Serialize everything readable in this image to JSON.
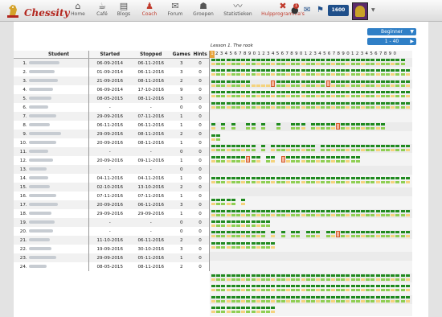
{
  "app": {
    "name": "Chessity"
  },
  "nav": [
    {
      "label": "Home",
      "icon": "home-icon",
      "glyph": "⌂"
    },
    {
      "label": "Café",
      "icon": "cafe-icon",
      "glyph": "☕"
    },
    {
      "label": "Blogs",
      "icon": "blogs-icon",
      "glyph": "▤"
    },
    {
      "label": "Coach",
      "icon": "coach-icon",
      "glyph": "♟",
      "active": true
    },
    {
      "label": "Forum",
      "icon": "forum-icon",
      "glyph": "✉"
    },
    {
      "label": "Groepen",
      "icon": "groups-icon",
      "glyph": "☗"
    },
    {
      "label": "Statistieken",
      "icon": "stats-icon",
      "glyph": "〰"
    },
    {
      "label": "Hulpprogramma's",
      "icon": "tools-icon",
      "glyph": "✖",
      "active": true
    }
  ],
  "user": {
    "notifications": "1",
    "rating": "1600"
  },
  "level_select": {
    "value": "Beginner"
  },
  "range_select": {
    "value": "1 - 40"
  },
  "lesson_title": "Lesson 1. The rook",
  "lesson_numbers": [
    "1",
    "2",
    "3",
    "4",
    "5",
    "6",
    "7",
    "8",
    "9",
    "0",
    "1",
    "2",
    "3",
    "4",
    "5",
    "6",
    "7",
    "8",
    "9",
    "0",
    "1",
    "2",
    "3",
    "4",
    "5",
    "6",
    "7",
    "8",
    "9",
    "0",
    "1",
    "2",
    "3",
    "4",
    "5",
    "6",
    "7",
    "8",
    "9",
    "0"
  ],
  "table": {
    "headers": {
      "student": "Student",
      "started": "Started",
      "stopped": "Stopped",
      "games": "Games",
      "hints": "Hints"
    },
    "rows": [
      {
        "num": "1.",
        "started": "06-09-2014",
        "stopped": "06-11-2016",
        "games": "3",
        "hints": "0",
        "progress": "ggggggggggggggggggggggggggggggggggggggg"
      },
      {
        "num": "2.",
        "started": "01-09-2014",
        "stopped": "06-11-2016",
        "games": "3",
        "hints": "0",
        "progress": "gggggggggggggggggggggggggggggggggggggggg"
      },
      {
        "num": "3.",
        "started": "21-09-2016",
        "stopped": "08-11-2016",
        "games": "2",
        "hints": "0",
        "progress": "ggggggggyyyyrggggggggggrgggggggggggggggg"
      },
      {
        "num": "4.",
        "started": "06-09-2014",
        "stopped": "17-10-2016",
        "games": "9",
        "hints": "0",
        "progress": "gggggggggggggggggggggggggggggggggggggggg"
      },
      {
        "num": "5.",
        "started": "08-05-2015",
        "stopped": "08-11-2016",
        "games": "3",
        "hints": "0",
        "progress": "gggggggggggggggggggggggggggggggggggggggg"
      },
      {
        "num": "6.",
        "started": "-",
        "stopped": "-",
        "games": "0",
        "hints": "0",
        "progress": ""
      },
      {
        "num": "7.",
        "started": "29-09-2016",
        "stopped": "07-11-2016",
        "games": "1",
        "hints": "0",
        "progress": "g.g.g..gg.g..g..ggg.gggggrggggggggg"
      },
      {
        "num": "8.",
        "started": "06-11-2016",
        "stopped": "06-11-2016",
        "games": "1",
        "hints": "0",
        "progress": "gg"
      },
      {
        "num": "9.",
        "started": "29-09-2016",
        "stopped": "08-11-2016",
        "games": "2",
        "hints": "0",
        "progress": "ggggggggg.g.ggggggggg.gggggggggggggggggg"
      },
      {
        "num": "10.",
        "started": "20-09-2016",
        "stopped": "08-11-2016",
        "games": "1",
        "hints": "0",
        "progress": "gggggggrgg.gg.rggggggggggggggg"
      },
      {
        "num": "11.",
        "started": "-",
        "stopped": "-",
        "games": "0",
        "hints": "0",
        "progress": ""
      },
      {
        "num": "12.",
        "started": "20-09-2016",
        "stopped": "09-11-2016",
        "games": "1",
        "hints": "0",
        "progress": "gggggggggggggggggggggggggggggggggggggggg"
      },
      {
        "num": "13.",
        "started": "-",
        "stopped": "-",
        "games": "0",
        "hints": "0",
        "progress": ""
      },
      {
        "num": "14.",
        "started": "04-11-2016",
        "stopped": "04-11-2016",
        "games": "1",
        "hints": "0",
        "progress": "ggggg.g"
      },
      {
        "num": "15.",
        "started": "02-10-2016",
        "stopped": "13-10-2016",
        "games": "2",
        "hints": "0",
        "progress": "gggggggggggggggggggggggggggggggggggggggg"
      },
      {
        "num": "16.",
        "started": "07-11-2016",
        "stopped": "07-11-2016",
        "games": "1",
        "hints": "0",
        "progress": "gggggggggggg"
      },
      {
        "num": "17.",
        "started": "20-09-2016",
        "stopped": "06-11-2016",
        "games": "3",
        "hints": "0",
        "progress": "ggggggggggg.g.g.gg.ggg.ggrgggggggggggggg"
      },
      {
        "num": "18.",
        "started": "29-09-2016",
        "stopped": "29-09-2016",
        "games": "1",
        "hints": "0",
        "progress": "ggggggggggggg"
      },
      {
        "num": "19.",
        "started": "-",
        "stopped": "-",
        "games": "0",
        "hints": "0",
        "progress": ""
      },
      {
        "num": "20.",
        "started": "-",
        "stopped": "-",
        "games": "0",
        "hints": "0",
        "progress": ""
      },
      {
        "num": "21.",
        "started": "11-10-2016",
        "stopped": "06-11-2016",
        "games": "2",
        "hints": "0",
        "progress": "gggggggggggggggggggggggggggggggggggggggg"
      },
      {
        "num": "22.",
        "started": "19-09-2016",
        "stopped": "30-10-2016",
        "games": "3",
        "hints": "0",
        "progress": "gggggggggggggggggggggggggggggggggggggggg"
      },
      {
        "num": "23.",
        "started": "29-09-2016",
        "stopped": "05-11-2016",
        "games": "1",
        "hints": "0",
        "progress": "gggggggggggggggggggggggggggggggggggggggg"
      },
      {
        "num": "24.",
        "started": "08-05-2015",
        "stopped": "08-11-2016",
        "games": "2",
        "hints": "0",
        "progress": "ggggggggggggg"
      }
    ]
  }
}
